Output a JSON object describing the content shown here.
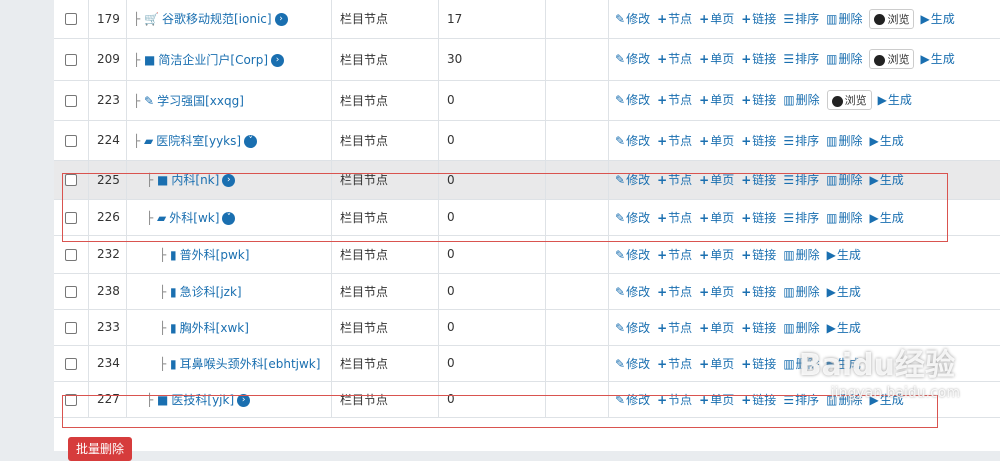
{
  "rows": [
    {
      "id": "179",
      "indent": 1,
      "icon": "cart",
      "name": "谷歌移动规范[ionic]",
      "expand": "right",
      "type": "栏目节点",
      "count": "17",
      "actions": [
        "修改",
        "节点",
        "单页",
        "链接",
        "排序",
        "删除"
      ],
      "browse": "浏览",
      "gen": "生成",
      "hl": false
    },
    {
      "id": "209",
      "indent": 1,
      "icon": "folder",
      "name": "简洁企业门户[Corp]",
      "expand": "right",
      "type": "栏目节点",
      "count": "30",
      "actions": [
        "修改",
        "节点",
        "单页",
        "链接",
        "排序",
        "删除"
      ],
      "browse": "浏览",
      "gen": "生成",
      "hl": false
    },
    {
      "id": "223",
      "indent": 1,
      "icon": "edit",
      "name": "学习强国[xxqg]",
      "expand": "",
      "type": "栏目节点",
      "count": "0",
      "actions": [
        "修改",
        "节点",
        "单页",
        "链接",
        "删除"
      ],
      "browse": "浏览",
      "gen": "生成",
      "hl": false
    },
    {
      "id": "224",
      "indent": 1,
      "icon": "folder-open",
      "name": "医院科室[yyks]",
      "expand": "down",
      "type": "栏目节点",
      "count": "0",
      "actions": [
        "修改",
        "节点",
        "单页",
        "链接",
        "排序",
        "删除"
      ],
      "browse": "",
      "gen": "生成",
      "hl": false
    },
    {
      "id": "225",
      "indent": 2,
      "icon": "folder",
      "name": "内科[nk]",
      "expand": "right",
      "type": "栏目节点",
      "count": "0",
      "actions": [
        "修改",
        "节点",
        "单页",
        "链接",
        "排序",
        "删除"
      ],
      "browse": "",
      "gen": "生成",
      "hl": true
    },
    {
      "id": "226",
      "indent": 2,
      "icon": "folder-open",
      "name": "外科[wk]",
      "expand": "down",
      "type": "栏目节点",
      "count": "0",
      "actions": [
        "修改",
        "节点",
        "单页",
        "链接",
        "排序",
        "删除"
      ],
      "browse": "",
      "gen": "生成",
      "hl": false
    },
    {
      "id": "232",
      "indent": 3,
      "icon": "file",
      "name": "普外科[pwk]",
      "expand": "",
      "type": "栏目节点",
      "count": "0",
      "actions": [
        "修改",
        "节点",
        "单页",
        "链接",
        "删除"
      ],
      "browse": "",
      "gen": "生成",
      "hl": false
    },
    {
      "id": "238",
      "indent": 3,
      "icon": "file",
      "name": "急诊科[jzk]",
      "expand": "",
      "type": "栏目节点",
      "count": "0",
      "actions": [
        "修改",
        "节点",
        "单页",
        "链接",
        "删除"
      ],
      "browse": "",
      "gen": "生成",
      "hl": false
    },
    {
      "id": "233",
      "indent": 3,
      "icon": "file",
      "name": "胸外科[xwk]",
      "expand": "",
      "type": "栏目节点",
      "count": "0",
      "actions": [
        "修改",
        "节点",
        "单页",
        "链接",
        "删除"
      ],
      "browse": "",
      "gen": "生成",
      "hl": false
    },
    {
      "id": "234",
      "indent": 3,
      "icon": "file",
      "name": "耳鼻喉头颈外科[ebhtjwk]",
      "expand": "",
      "type": "栏目节点",
      "count": "0",
      "actions": [
        "修改",
        "节点",
        "单页",
        "链接",
        "删除"
      ],
      "browse": "",
      "gen": "生成",
      "hl": false
    },
    {
      "id": "227",
      "indent": 2,
      "icon": "folder",
      "name": "医技科[yjk]",
      "expand": "right",
      "type": "栏目节点",
      "count": "0",
      "actions": [
        "修改",
        "节点",
        "单页",
        "链接",
        "排序",
        "删除"
      ],
      "browse": "",
      "gen": "生成",
      "hl": false
    }
  ],
  "batch_delete": "批量删除",
  "watermark": "Baidu经验",
  "watermark_sub": "jingyan.baidu.com"
}
